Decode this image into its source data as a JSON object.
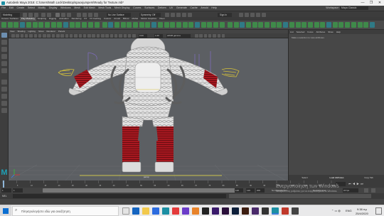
{
  "window": {
    "title": "Autodesk Maya 2018: C:\\Users\\Math Lock\\Desktop\\spacejumpers\\Ready for Texture.mb*",
    "min": "—",
    "max": "❐",
    "close": "✕"
  },
  "menubar": {
    "items": [
      "File",
      "Edit",
      "Create",
      "Select",
      "Modify",
      "Display",
      "Windows",
      "Mesh",
      "Edit Mesh",
      "Mesh Tools",
      "Mesh Display",
      "Curves",
      "Surfaces",
      "Deform",
      "UV",
      "Generate",
      "Cache",
      "Arnold",
      "Help"
    ],
    "workspace": "Workspace :",
    "workspace_value": "Maya Classic"
  },
  "statusline": {
    "mode": "Modeling",
    "no_live": "No Live Surface",
    "symmetry": "Symmetry: Off",
    "signin": "Sign In"
  },
  "shelf": {
    "tabs": [
      "Curves / Surfaces",
      "Poly Modeling",
      "Sculpting",
      "Rigging",
      "Animation",
      "Rendering",
      "FX",
      "FX Caching",
      "Custom",
      "Arnold",
      "Bifrost",
      "MASH",
      "Motion Graphics",
      "XGen"
    ],
    "active": "Poly Modeling"
  },
  "viewport": {
    "menu": [
      "View",
      "Shading",
      "Lighting",
      "Show",
      "Renderer",
      "Panels"
    ],
    "camera": "persp",
    "numbers": {
      "left": "0.00",
      "right": "1.00"
    },
    "colorspace": "sRGB gamma"
  },
  "right_panel": {
    "tabs": [
      "List",
      "Selected",
      "Focus",
      "Attributes",
      "Show",
      "Help"
    ],
    "message": "Make a selection to view attributes",
    "bottom": {
      "select": "Select",
      "load": "Load Attributes",
      "copy": "Copy Tab"
    }
  },
  "timeslider": {
    "ticks": [
      "1",
      "5",
      "10",
      "15",
      "20",
      "25",
      "30",
      "35",
      "40",
      "45",
      "50",
      "55",
      "60",
      "65",
      "70",
      "75",
      "80",
      "85",
      "90",
      "95",
      "100",
      "105",
      "110",
      "115",
      "120"
    ],
    "current": "1"
  },
  "range": {
    "start": "1",
    "inner_start": "1",
    "inner_end": "120",
    "end": "120",
    "end2": "200",
    "character_set": "No Character Set",
    "anim_layer": "No Anim Layer",
    "fps": "24 fps"
  },
  "cmdline": {
    "label": "MEL"
  },
  "watermark": {
    "title": "Ενεργοποίηση των Windows",
    "subtitle": "Μεταβείτε στις ρυθμίσεις για να ενεργοποιηθούν τα Windows."
  },
  "taskbar": {
    "search_placeholder": "Πληκτρολογήστε εδώ για αναζήτηση",
    "lang": "ENG",
    "time": "9:38 πμ",
    "date": "25/4/2020"
  },
  "colors": {
    "maya_teal": "#1c8fa3",
    "shelf_green": "#3f8a4a",
    "suit_red": "#a81820",
    "guide_yellow": "#d6c23a",
    "guide_purple": "#7d6bb8",
    "viewport_bg": "#5c5f63"
  }
}
